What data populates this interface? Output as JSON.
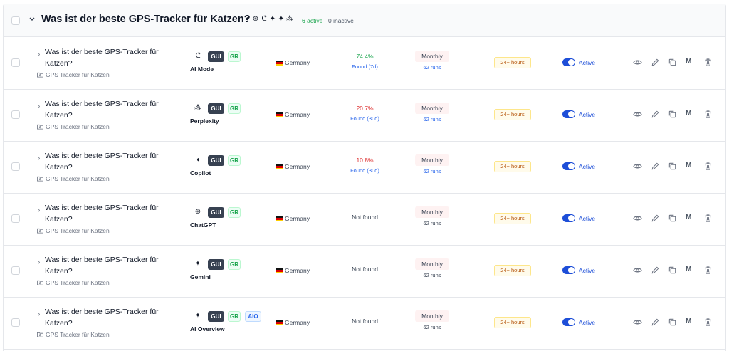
{
  "group": {
    "title": "Was ist der beste GPS-Tracker für Katzen?",
    "engine_icons": [
      "copilot-icon",
      "chatgpt-icon",
      "ai-mode-icon",
      "gemini-icon",
      "ai-overview-icon",
      "perplexity-icon"
    ],
    "active_label": "6 active",
    "inactive_label": "0 inactive"
  },
  "colors": {
    "accent": "#1d4ed8",
    "positive": "#16a34a",
    "negative": "#dc2626",
    "link": "#2563eb"
  },
  "rows": [
    {
      "query": "Was ist der beste GPS-Tracker für Katzen?",
      "tag": "GPS Tracker für Katzen",
      "engine_icon": "ai-mode-icon",
      "engine_glyph": "ᕦ",
      "engine": "AI Mode",
      "badges": [
        "GUI",
        "GR"
      ],
      "country": "Germany",
      "visibility": "74.4%",
      "visibility_color": "#16a34a",
      "found": "Found (7d)",
      "frequency": "Monthly",
      "runs": "62 runs",
      "runs_link": true,
      "hours": "24+ hours",
      "status": "Active"
    },
    {
      "query": "Was ist der beste GPS-Tracker für Katzen?",
      "tag": "GPS Tracker für Katzen",
      "engine_icon": "perplexity-icon",
      "engine_glyph": "⁂",
      "engine": "Perplexity",
      "badges": [
        "GUI",
        "GR"
      ],
      "country": "Germany",
      "visibility": "20.7%",
      "visibility_color": "#dc2626",
      "found": "Found (30d)",
      "frequency": "Monthly",
      "runs": "62 runs",
      "runs_link": true,
      "hours": "24+ hours",
      "status": "Active"
    },
    {
      "query": "Was ist der beste GPS-Tracker für Katzen?",
      "tag": "GPS Tracker für Katzen",
      "engine_icon": "copilot-icon",
      "engine_glyph": "◖",
      "engine": "Copilot",
      "badges": [
        "GUI",
        "GR"
      ],
      "country": "Germany",
      "visibility": "10.8%",
      "visibility_color": "#dc2626",
      "found": "Found (30d)",
      "frequency": "Monthly",
      "runs": "62 runs",
      "runs_link": true,
      "hours": "24+ hours",
      "status": "Active"
    },
    {
      "query": "Was ist der beste GPS-Tracker für Katzen?",
      "tag": "GPS Tracker für Katzen",
      "engine_icon": "chatgpt-icon",
      "engine_glyph": "⊛",
      "engine": "ChatGPT",
      "badges": [
        "GUI",
        "GR"
      ],
      "country": "Germany",
      "visibility": "Not found",
      "visibility_color": "",
      "found": "",
      "frequency": "Monthly",
      "runs": "62 runs",
      "runs_link": false,
      "hours": "24+ hours",
      "status": "Active"
    },
    {
      "query": "Was ist der beste GPS-Tracker für Katzen?",
      "tag": "GPS Tracker für Katzen",
      "engine_icon": "gemini-icon",
      "engine_glyph": "✦",
      "engine": "Gemini",
      "badges": [
        "GUI",
        "GR"
      ],
      "country": "Germany",
      "visibility": "Not found",
      "visibility_color": "",
      "found": "",
      "frequency": "Monthly",
      "runs": "62 runs",
      "runs_link": false,
      "hours": "24+ hours",
      "status": "Active"
    },
    {
      "query": "Was ist der beste GPS-Tracker für Katzen?",
      "tag": "GPS Tracker für Katzen",
      "engine_icon": "ai-overview-icon",
      "engine_glyph": "✦",
      "engine": "AI Overview",
      "badges": [
        "GUI",
        "GR",
        "AIO"
      ],
      "country": "Germany",
      "visibility": "Not found",
      "visibility_color": "",
      "found": "",
      "frequency": "Monthly",
      "runs": "62 runs",
      "runs_link": false,
      "hours": "24+ hours",
      "status": "Active"
    }
  ],
  "actions": {
    "monitor_label": "M"
  }
}
